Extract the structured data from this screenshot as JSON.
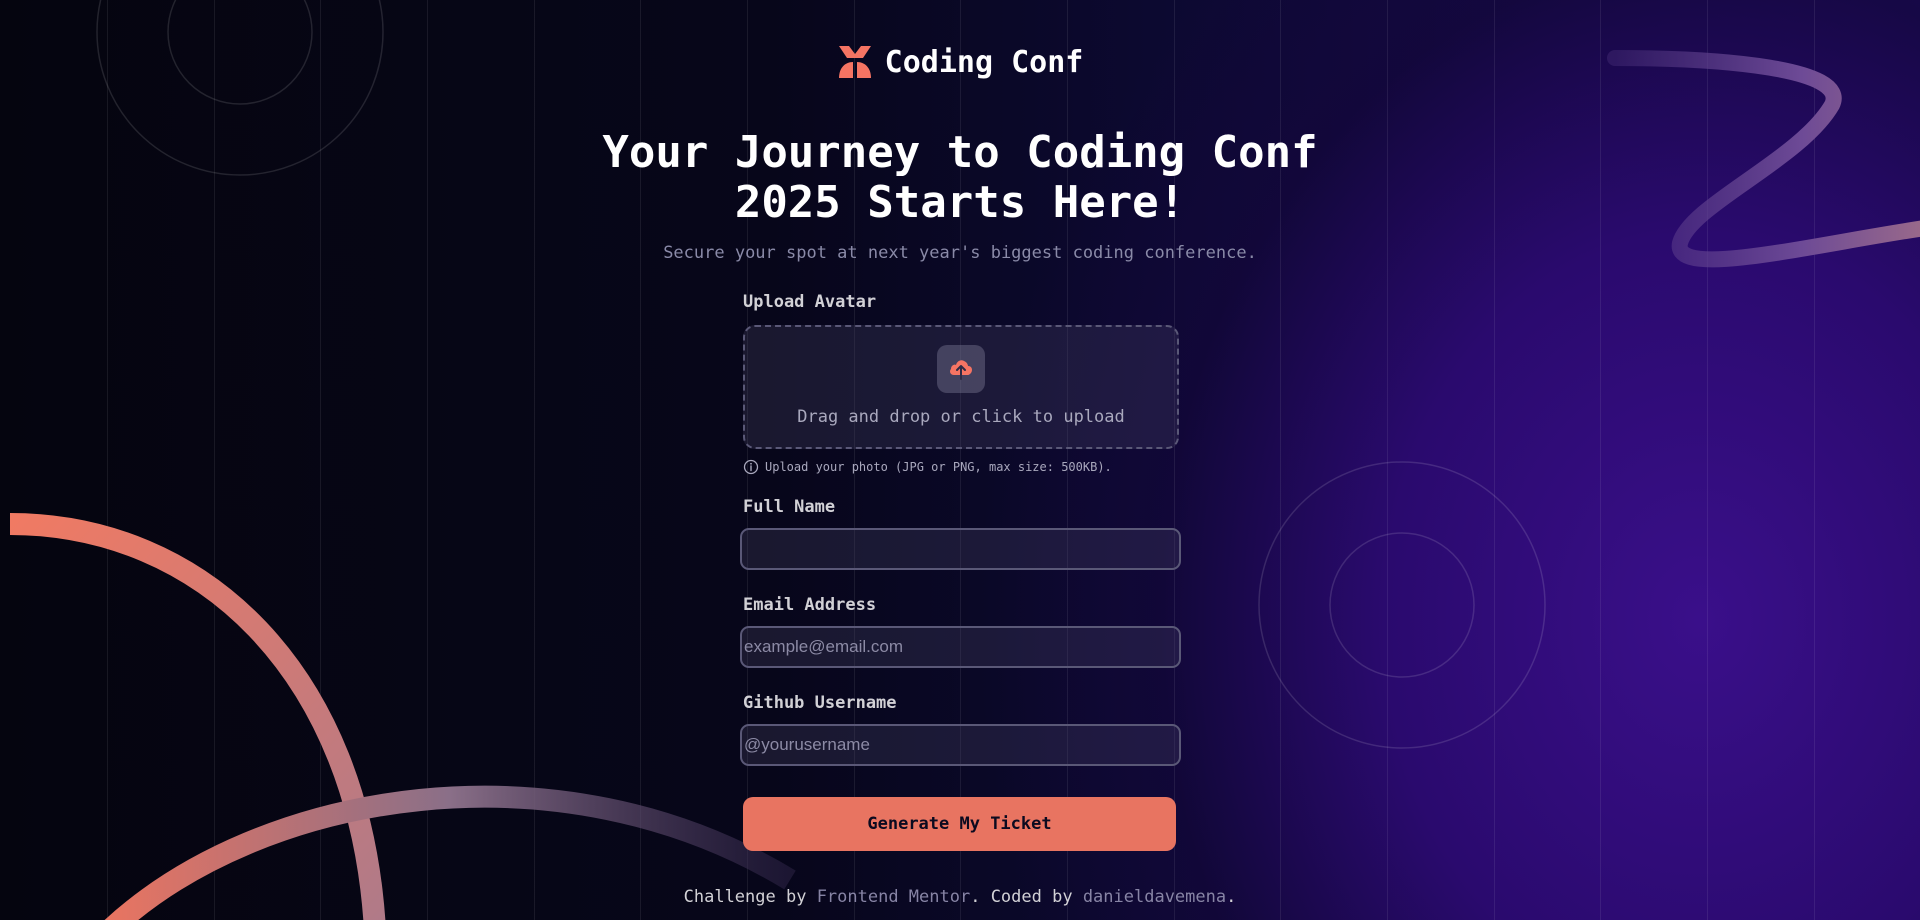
{
  "header": {
    "logo_text": "Coding Conf"
  },
  "hero": {
    "title_line1": "Your Journey to Coding Conf",
    "title_line2": "2025 Starts Here!",
    "subtitle": "Secure your spot at next year's biggest coding conference."
  },
  "form": {
    "avatar_label": "Upload Avatar",
    "drop_text": "Drag and drop or click to upload",
    "hint": "Upload your photo (JPG or PNG, max size: 500KB).",
    "full_name_label": "Full Name",
    "full_name_value": "",
    "email_label": "Email Address",
    "email_placeholder": "example@email.com",
    "github_label": "Github Username",
    "github_placeholder": "@yourusername",
    "submit_label": "Generate My Ticket"
  },
  "footer": {
    "prefix": "Challenge by ",
    "link1": "Frontend Mentor",
    "middle": ". Coded by ",
    "link2": "danieldavemena",
    "suffix": "."
  },
  "colors": {
    "accent": "#e87461",
    "background": "#07061a",
    "muted_text": "#8a8aa8",
    "field_border": "#5a5877"
  },
  "icons": [
    "logo-icon",
    "upload-cloud-icon",
    "info-icon"
  ]
}
